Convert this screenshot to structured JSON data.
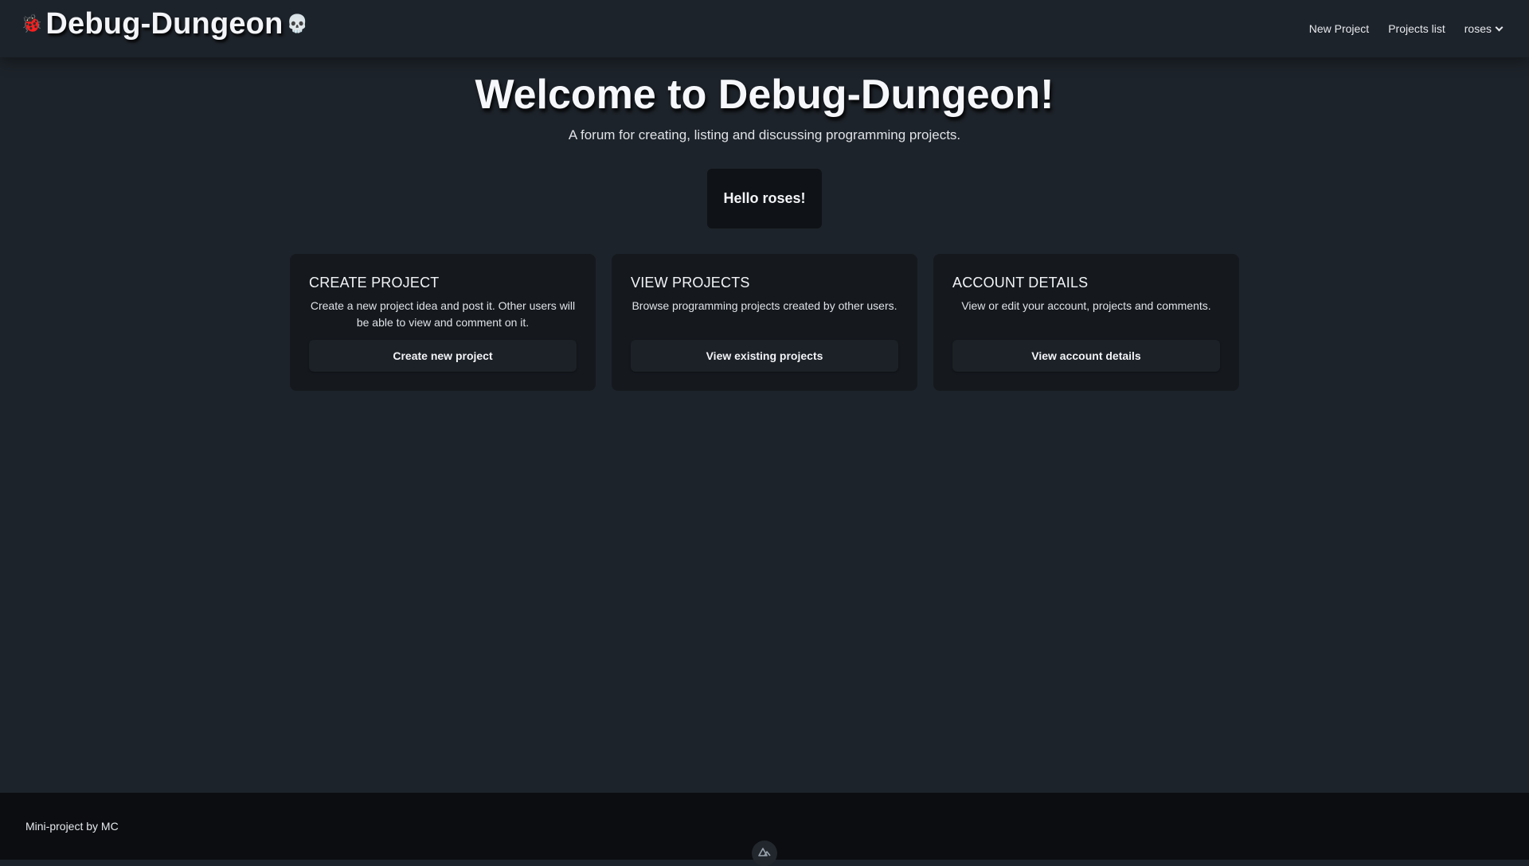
{
  "header": {
    "bug_glyph": "🐞",
    "brand": "Debug-Dungeon",
    "skull_glyph": "💀",
    "nav": {
      "new_project": "New Project",
      "projects_list": "Projects list",
      "user": "roses"
    }
  },
  "hero": {
    "title": "Welcome to Debug-Dungeon!",
    "subtitle": "A forum for creating, listing and discussing programming projects.",
    "greeting": "Hello roses!"
  },
  "cards": [
    {
      "title": "CREATE PROJECT",
      "description": "Create a new project idea and post it. Other users will be able to view and comment on it.",
      "button": "Create new project"
    },
    {
      "title": "VIEW PROJECTS",
      "description": "Browse programming projects created by other users.",
      "button": "View existing projects"
    },
    {
      "title": "ACCOUNT DETAILS",
      "description": "View or edit your account, projects and comments.",
      "button": "View account details"
    }
  ],
  "footer": {
    "credit": "Mini-project by MC"
  },
  "colors": {
    "background": "#1d232a",
    "card": "#15191e",
    "footer": "#0b0d10",
    "text": "#e6e9ee"
  }
}
